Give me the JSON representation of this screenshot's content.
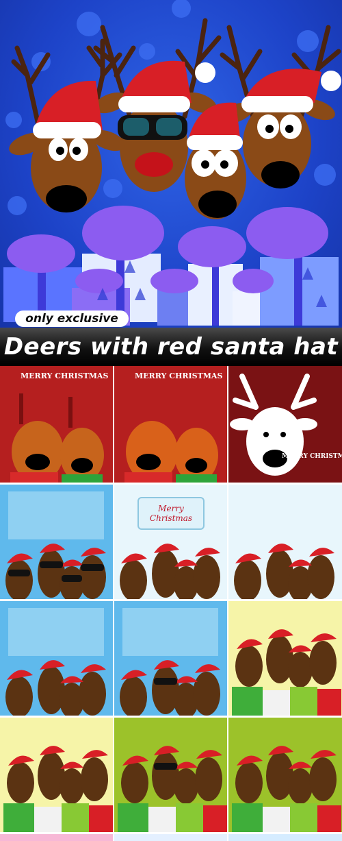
{
  "hero": {
    "badge_text": "only exclusive",
    "colors": {
      "sky": "#1d43c8",
      "hat": "#d81f26",
      "gift": "#6a5cf0"
    }
  },
  "banner": {
    "title": "Deers with red santa hat"
  },
  "thumbnails": [
    {
      "caption": "MERRY CHRISTMAS",
      "bg": "#b51f1f"
    },
    {
      "caption": "MERRY CHRISTMAS",
      "bg": "#b51f1f"
    },
    {
      "caption": "MERRY CHRISTMAS",
      "bg": "#7a1214"
    },
    {
      "bg": "#5fb9ec"
    },
    {
      "caption_line1": "Merry",
      "caption_line2": "Christmas",
      "bg": "#e8f6fc"
    },
    {
      "bg": "#e8f6fc"
    },
    {
      "bg": "#5fb9ec"
    },
    {
      "bg": "#5fb9ec"
    },
    {
      "bg": "#f6f4a8"
    },
    {
      "bg": "#f6f4a8"
    },
    {
      "bg": "#9cc22a"
    },
    {
      "bg": "#9cc22a"
    }
  ]
}
